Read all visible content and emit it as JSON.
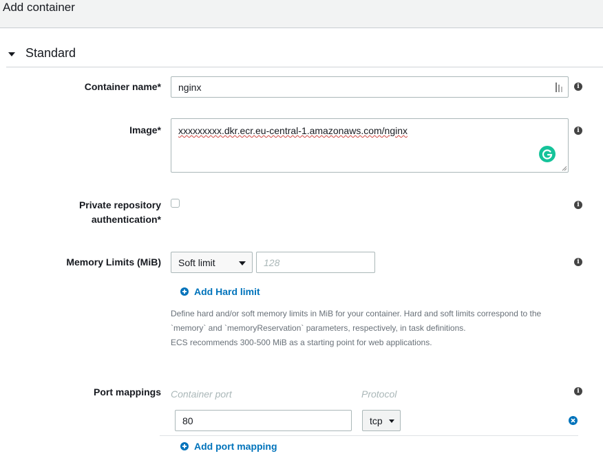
{
  "header": {
    "title": "Add container"
  },
  "section": {
    "title": "Standard"
  },
  "fields": {
    "container_name": {
      "label": "Container name*",
      "value": "nginx"
    },
    "image": {
      "label": "Image*",
      "value": "xxxxxxxxx.dkr.ecr.eu-central-1.amazonaws.com/nginx"
    },
    "private_repo": {
      "label_line1": "Private repository",
      "label_line2": "authentication*",
      "checked": false
    },
    "memory": {
      "label": "Memory Limits (MiB)",
      "limit_type": "Soft limit",
      "placeholder": "128",
      "add_link": "Add Hard limit",
      "help_line1": "Define hard and/or soft memory limits in MiB for your container. Hard and soft limits correspond to the",
      "help_line2": "`memory` and `memoryReservation` parameters, respectively, in task definitions.",
      "help_line3": "ECS recommends 300-500 MiB as a starting point for web applications."
    },
    "port_mappings": {
      "label": "Port mappings",
      "container_port_header": "Container port",
      "protocol_header": "Protocol",
      "rows": [
        {
          "container_port": "80",
          "protocol": "tcp"
        }
      ],
      "add_link": "Add port mapping"
    }
  },
  "icons": {
    "info": "info-icon",
    "add": "plus-circle-icon",
    "remove": "remove-circle-icon",
    "grammarly": "grammarly-icon"
  },
  "colors": {
    "link": "#0073bb",
    "grammarly": "#15c39a",
    "header_bg": "#f2f3f3"
  }
}
